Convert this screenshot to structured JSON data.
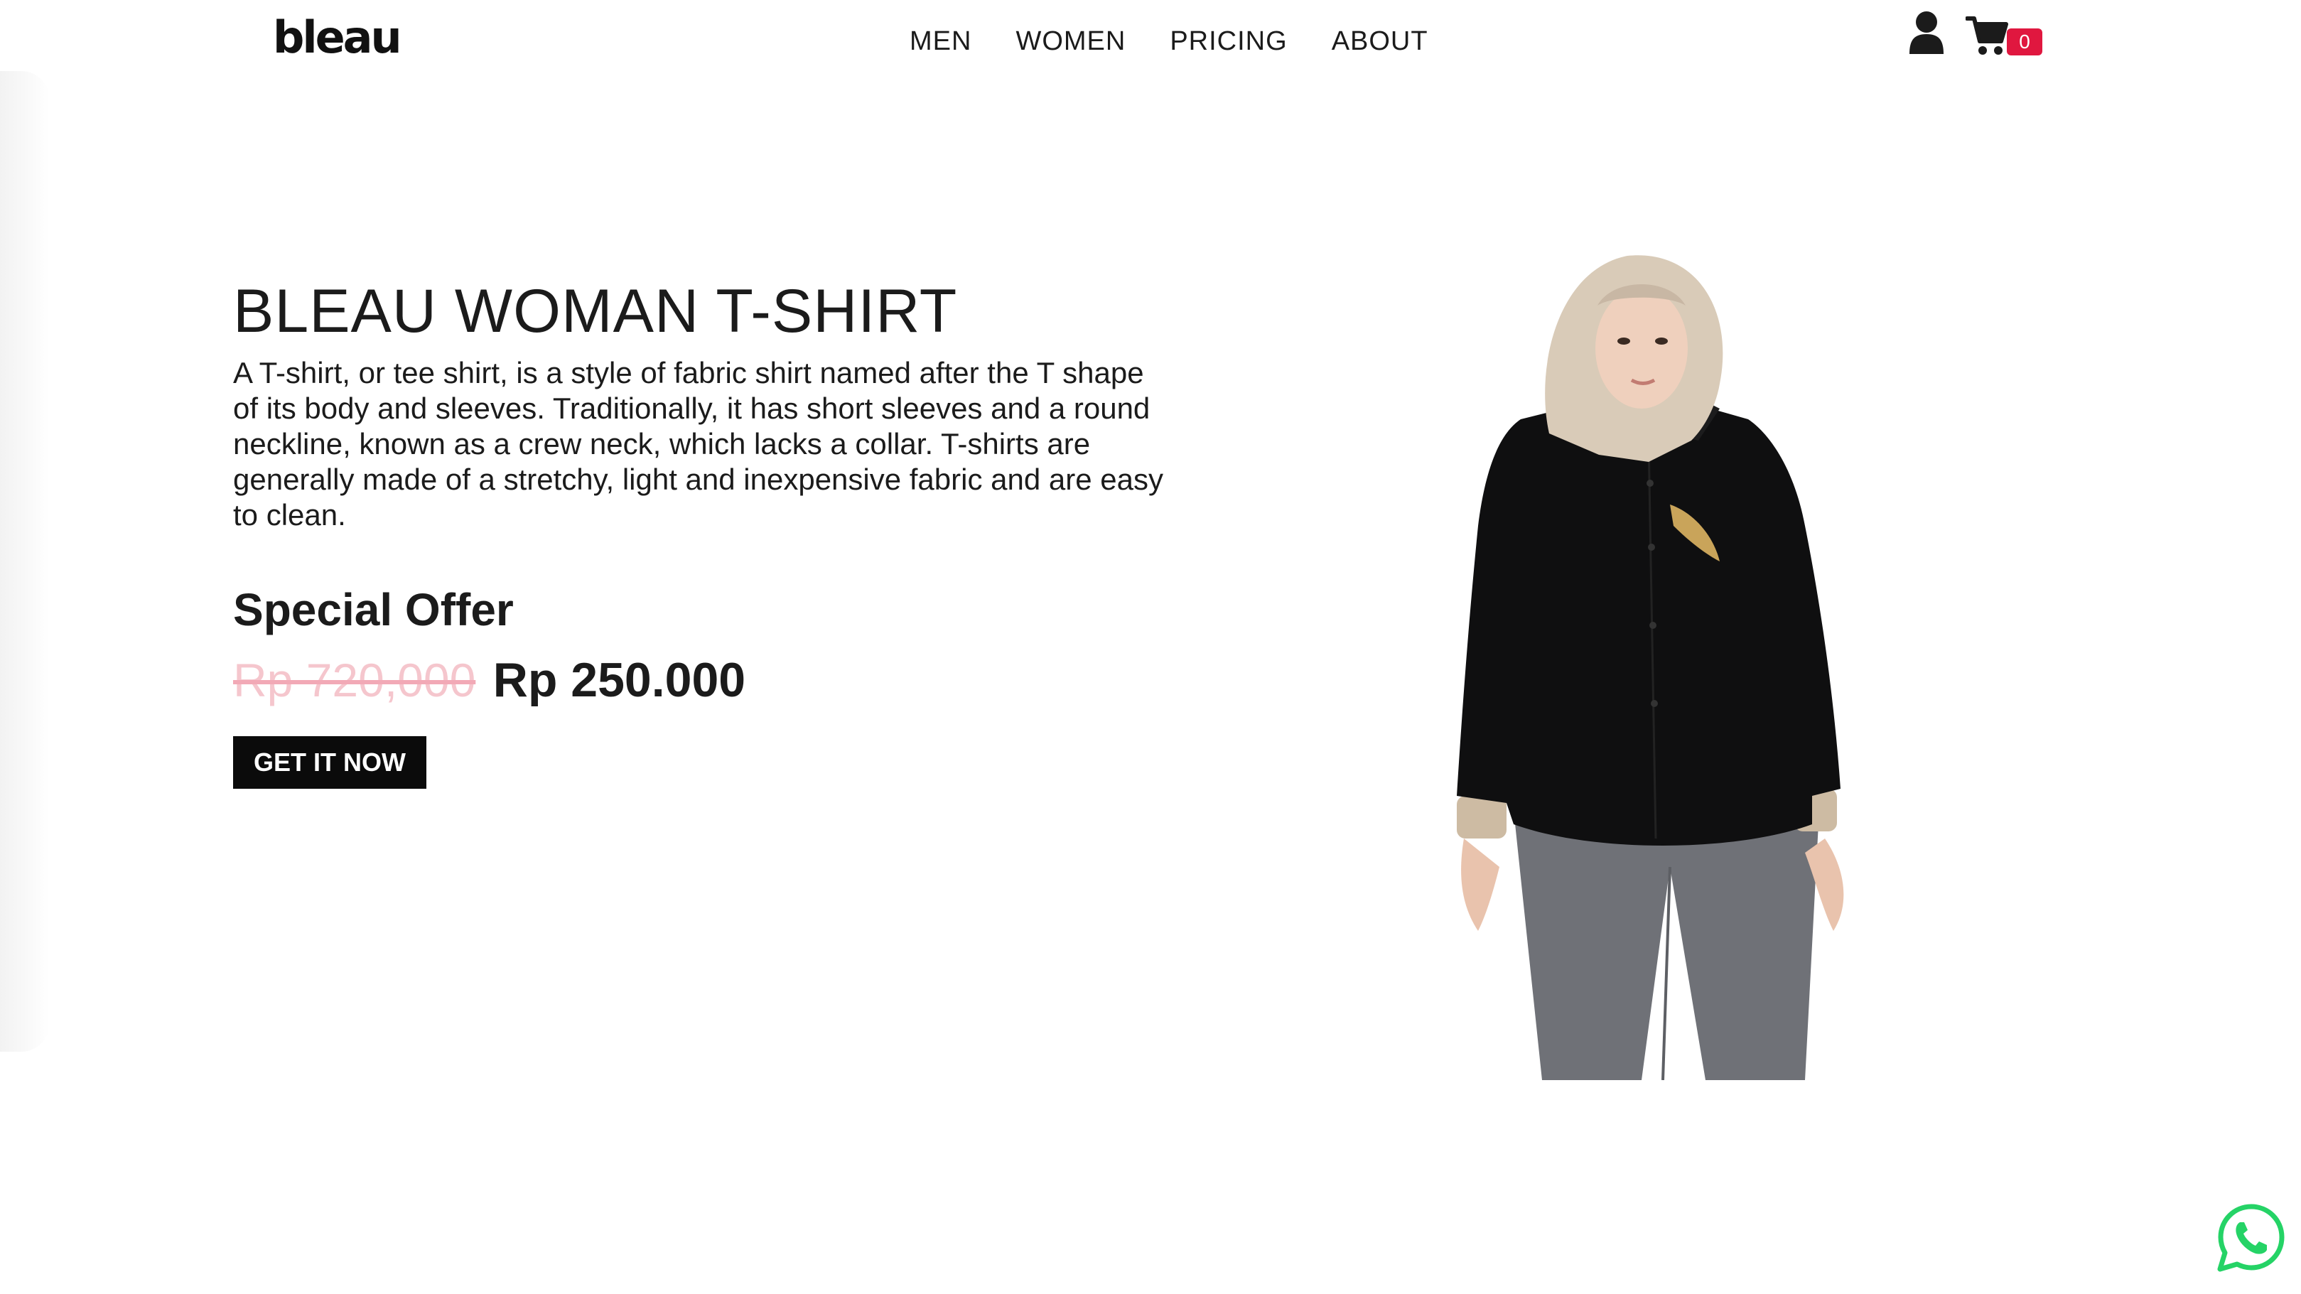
{
  "header": {
    "logo": "bleau",
    "nav": [
      "MEN",
      "WOMEN",
      "PRICING",
      "ABOUT"
    ],
    "cart_count": "0",
    "icons": [
      "user-icon",
      "cart-icon"
    ]
  },
  "hero": {
    "title": "BLEAU WOMAN T-SHIRT",
    "description": "A T-shirt, or tee shirt, is a style of fabric shirt named after the T shape of its body and sleeves. Traditionally, it has short sleeves and a round neckline, known as a crew neck, which lacks a collar. T-shirts are generally made of a stretchy, light and inexpensive fabric and are easy to clean.",
    "offer_label": "Special Offer",
    "old_price": "Rp 720,000",
    "new_price": "Rp 250.000",
    "cta_label": "GET IT NOW"
  },
  "floating": {
    "icon": "whatsapp-icon"
  },
  "colors": {
    "badge": "#e0173f",
    "old_price": "#f5c6cd",
    "cta_bg": "#0b0b0b",
    "whatsapp": "#25d366"
  }
}
